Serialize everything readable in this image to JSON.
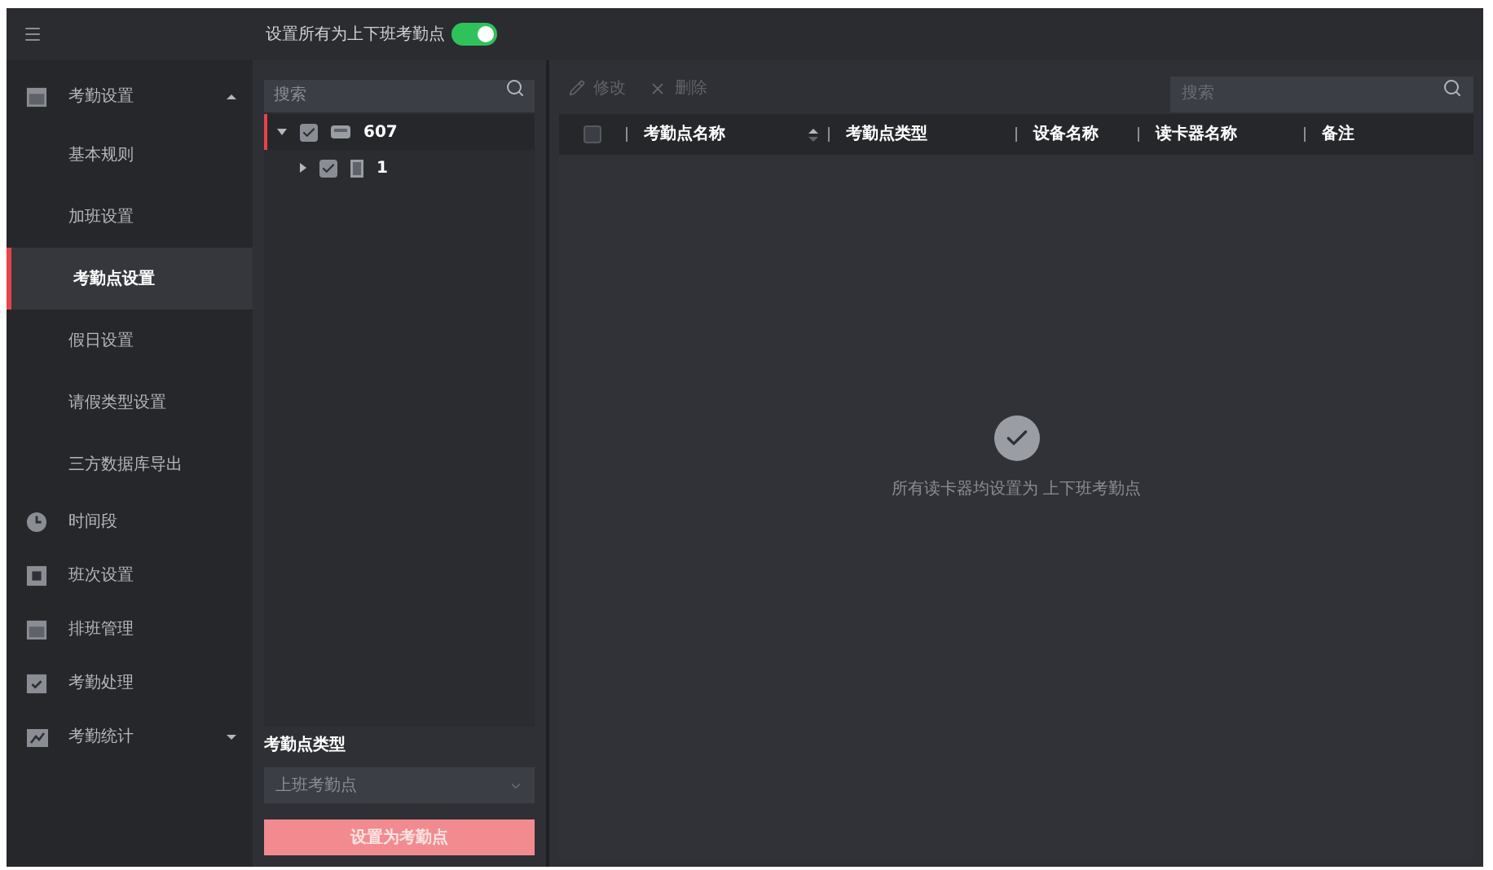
{
  "top_bar": {
    "toggle": {
      "label": "设置所有为上下班考勤点",
      "on": true
    }
  },
  "sidebar": {
    "items": [
      {
        "label": "考勤设置",
        "kind": "group",
        "expanded": true,
        "selected": false,
        "children": [
          {
            "label": "基本规则",
            "selected": false
          },
          {
            "label": "加班设置",
            "selected": false
          },
          {
            "label": "考勤点设置",
            "selected": true
          },
          {
            "label": "假日设置",
            "selected": false
          },
          {
            "label": "请假类型设置",
            "selected": false
          },
          {
            "label": "三方数据库导出",
            "selected": false
          }
        ]
      },
      {
        "label": "时间段",
        "kind": "link",
        "selected": false
      },
      {
        "label": "班次设置",
        "kind": "link",
        "selected": false
      },
      {
        "label": "排班管理",
        "kind": "link",
        "selected": false
      },
      {
        "label": "考勤处理",
        "kind": "link",
        "selected": false
      },
      {
        "label": "考勤统计",
        "kind": "group",
        "expanded": false,
        "selected": false
      }
    ]
  },
  "tree_panel": {
    "search": {
      "placeholder": "搜索"
    },
    "nodes": [
      {
        "label": "607",
        "checked": true,
        "expanded": true,
        "selected": true,
        "children": [
          {
            "label": "1",
            "checked": true,
            "expanded": false,
            "selected": false
          }
        ]
      }
    ],
    "type_field": {
      "label": "考勤点类型",
      "value": "上班考勤点"
    },
    "apply_button": {
      "label": "设置为考勤点",
      "disabled": true
    }
  },
  "main": {
    "toolbar": {
      "buttons": [
        {
          "label": "修改",
          "disabled": true
        },
        {
          "label": "删除",
          "disabled": true
        }
      ],
      "search": {
        "placeholder": "搜索"
      }
    },
    "table": {
      "select_all": {
        "checked": false
      },
      "columns": [
        {
          "label": "考勤点名称",
          "sortable": true
        },
        {
          "label": "考勤点类型",
          "sortable": false
        },
        {
          "label": "设备名称",
          "sortable": false
        },
        {
          "label": "读卡器名称",
          "sortable": false
        },
        {
          "label": "备注",
          "sortable": false
        }
      ],
      "empty_message": "所有读卡器均设置为 上下班考勤点"
    }
  }
}
